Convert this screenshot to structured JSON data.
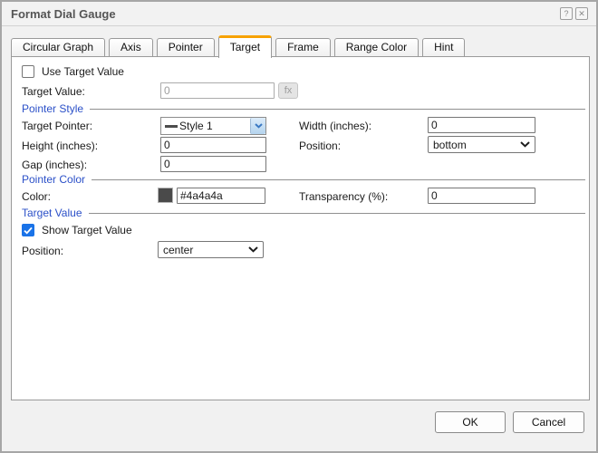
{
  "window": {
    "title": "Format Dial Gauge",
    "help_icon": "?",
    "close_icon": "✕"
  },
  "tabs": [
    {
      "label": "Circular Graph"
    },
    {
      "label": "Axis"
    },
    {
      "label": "Pointer"
    },
    {
      "label": "Target"
    },
    {
      "label": "Frame"
    },
    {
      "label": "Range Color"
    },
    {
      "label": "Hint"
    }
  ],
  "active_tab": "Target",
  "panel": {
    "use_target_value": {
      "label": "Use Target Value",
      "checked": false
    },
    "target_value_field": {
      "label": "Target Value:",
      "value": "0",
      "disabled": true,
      "fx_button": "fx"
    },
    "pointer_style_section": {
      "title": "Pointer Style",
      "target_pointer": {
        "label": "Target Pointer:",
        "value": "Style 1"
      },
      "width": {
        "label": "Width (inches):",
        "value": "0"
      },
      "height": {
        "label": "Height (inches):",
        "value": "0"
      },
      "position": {
        "label": "Position:",
        "value": "bottom"
      },
      "gap": {
        "label": "Gap (inches):",
        "value": "0"
      }
    },
    "pointer_color_section": {
      "title": "Pointer Color",
      "color": {
        "label": "Color:",
        "value": "#4a4a4a",
        "swatch_color": "#4a4a4a"
      },
      "transparency": {
        "label": "Transparency (%):",
        "value": "0"
      }
    },
    "target_value_section": {
      "title": "Target Value",
      "show_target_value": {
        "label": "Show Target Value",
        "checked": true
      },
      "position": {
        "label": "Position:",
        "value": "center"
      }
    }
  },
  "footer": {
    "ok": "OK",
    "cancel": "Cancel"
  },
  "colors": {
    "active_tab_accent": "#f7a200",
    "section_title_blue": "#2b50c8",
    "checkbox_checked_blue": "#1a73e8",
    "pointer_color_swatch": "#4a4a4a"
  }
}
